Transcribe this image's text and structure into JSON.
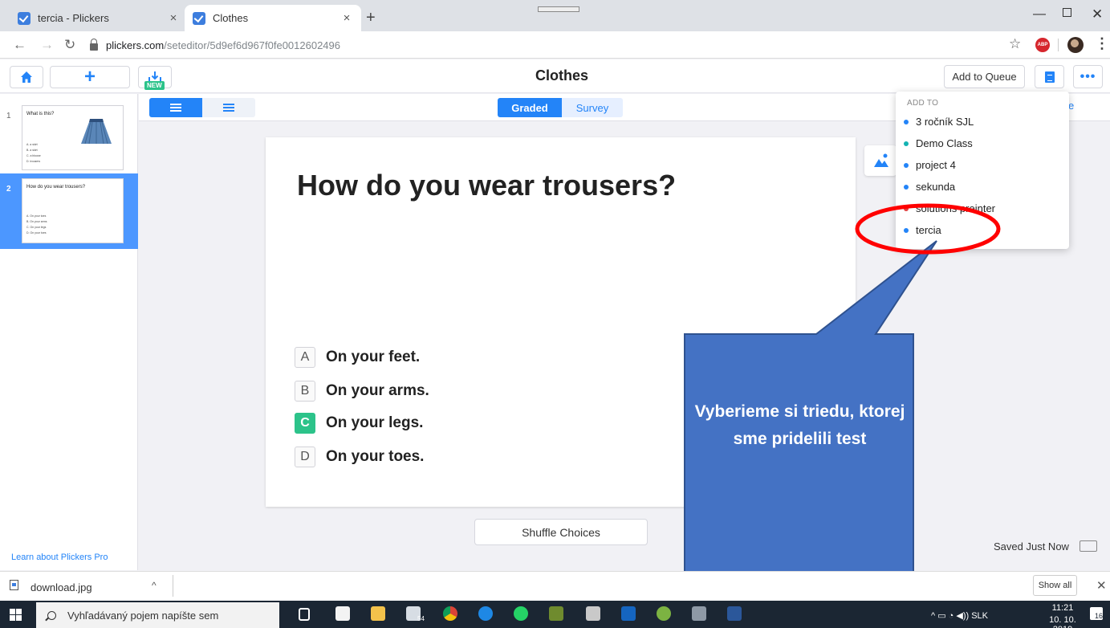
{
  "browser": {
    "tabs": [
      {
        "title": "tercia - Plickers",
        "active": false
      },
      {
        "title": "Clothes",
        "active": true
      }
    ],
    "url_host": "plickers.com",
    "url_path": "/seteditor/5d9ef6d967f0fe0012602496",
    "abp_label": "ABP"
  },
  "app": {
    "set_title": "Clothes",
    "new_badge": "NEW",
    "add_to_queue_label": "Add to Queue",
    "graded_label": "Graded",
    "survey_label": "Survey",
    "delete_label": "elete",
    "learn_pro_label": "Learn about Plickers Pro",
    "shuffle_label": "Shuffle Choices",
    "saved_status": "Saved Just Now",
    "accent_color": "#2384f8",
    "correct_color": "#2cc38a"
  },
  "slides": [
    {
      "number": "1",
      "question": "What is this?",
      "choices": [
        "a skirt",
        "a skirt",
        "a blouse",
        "trousers"
      ],
      "selected": false
    },
    {
      "number": "2",
      "question": "How do you wear trousers?",
      "choices": [
        "On your toes",
        "On your arms",
        "On your legs",
        "On your toes"
      ],
      "selected": true
    }
  ],
  "question": {
    "text": "How do you wear trousers?",
    "choices": [
      {
        "letter": "A",
        "text": "On your feet.",
        "correct": false
      },
      {
        "letter": "B",
        "text": "On your arms.",
        "correct": false
      },
      {
        "letter": "C",
        "text": "On your legs.",
        "correct": true
      },
      {
        "letter": "D",
        "text": "On your toes.",
        "correct": false
      }
    ]
  },
  "dropdown": {
    "header": "ADD TO",
    "classes": [
      {
        "name": "3 ročník SJL",
        "color": "#2384f8"
      },
      {
        "name": "Demo Class",
        "color": "#14b3b3"
      },
      {
        "name": "project 4",
        "color": "#2384f8"
      },
      {
        "name": "sekunda",
        "color": "#2384f8"
      },
      {
        "name": "solutions preinter",
        "color": "#e04040"
      },
      {
        "name": "tercia",
        "color": "#2384f8"
      }
    ]
  },
  "annotation": {
    "callout_text": "Vyberieme si triedu, ktorej sme pridelili test",
    "callout_color": "#4472c4",
    "ellipse_color": "#ff0000"
  },
  "downloads": {
    "file_name": "download.jpg",
    "show_all_label": "Show all"
  },
  "taskbar": {
    "search_placeholder": "Vyhľadávaný pojem napíšte sem",
    "mail_badge": "54",
    "language": "SLK",
    "time": "11:21",
    "date": "10. 10. 2019",
    "notification_count": "16"
  }
}
